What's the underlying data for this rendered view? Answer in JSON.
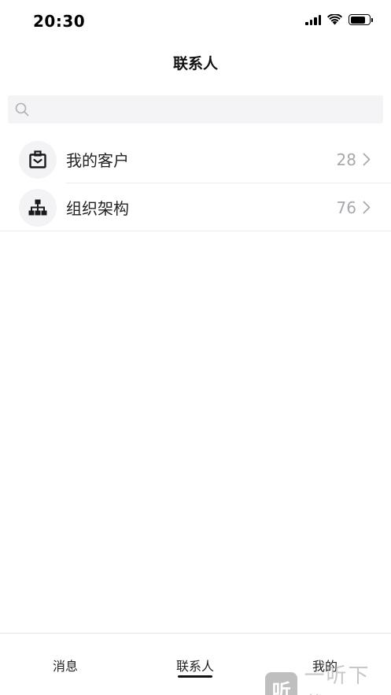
{
  "status_bar": {
    "time": "20:30",
    "icons": [
      "signal-icon",
      "wifi-icon",
      "battery-icon"
    ]
  },
  "nav": {
    "title": "联系人"
  },
  "search": {
    "placeholder": "",
    "value": ""
  },
  "list": {
    "items": [
      {
        "label": "我的客户",
        "count": "28",
        "icon": "customer-bag-icon"
      },
      {
        "label": "组织架构",
        "count": "76",
        "icon": "org-chart-icon"
      }
    ]
  },
  "tab_bar": {
    "tabs": [
      {
        "label": "消息",
        "selected": false
      },
      {
        "label": "联系人",
        "selected": true
      },
      {
        "label": "我的",
        "selected": false
      }
    ]
  },
  "watermark": {
    "text": "一听下载",
    "logo": "听"
  },
  "colors": {
    "search_bg": "#f4f4f6",
    "count_text": "#a8a8ad",
    "icon_bg": "#f3f3f5",
    "active_indicator": "#111111"
  }
}
